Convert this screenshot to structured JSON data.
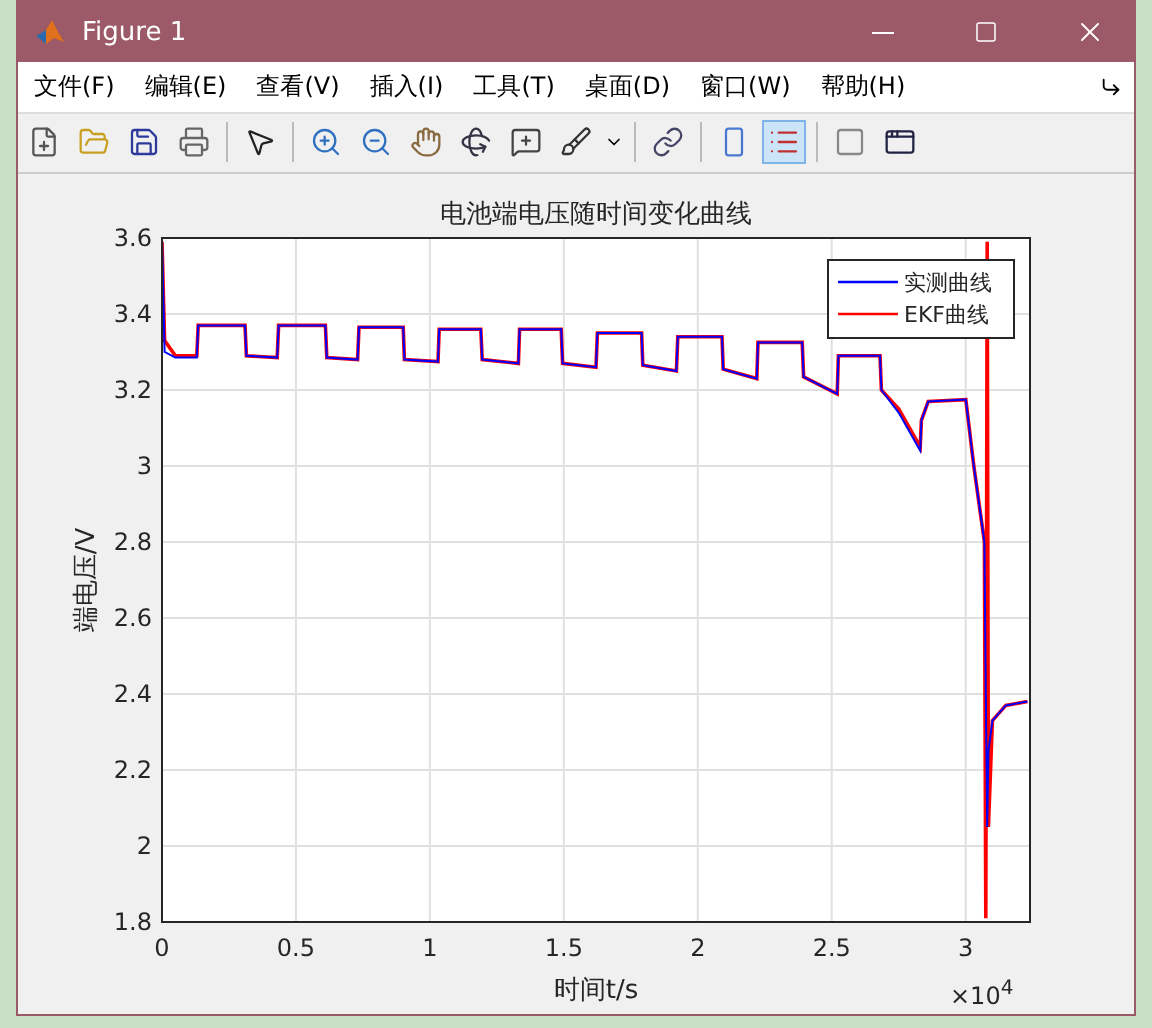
{
  "window": {
    "title": "Figure 1"
  },
  "menu": [
    {
      "label": "文件(F)"
    },
    {
      "label": "编辑(E)"
    },
    {
      "label": "查看(V)"
    },
    {
      "label": "插入(I)"
    },
    {
      "label": "工具(T)"
    },
    {
      "label": "桌面(D)"
    },
    {
      "label": "窗口(W)"
    },
    {
      "label": "帮助(H)"
    }
  ],
  "toolbar": [
    {
      "kind": "new",
      "selected": false
    },
    {
      "kind": "open",
      "selected": false
    },
    {
      "kind": "save",
      "selected": false
    },
    {
      "kind": "print",
      "selected": false
    },
    {
      "kind": "sep"
    },
    {
      "kind": "pointer",
      "selected": false
    },
    {
      "kind": "sep"
    },
    {
      "kind": "zoomin",
      "selected": false
    },
    {
      "kind": "zoomout",
      "selected": false
    },
    {
      "kind": "pan",
      "selected": false
    },
    {
      "kind": "rotate",
      "selected": false
    },
    {
      "kind": "datatip",
      "selected": false
    },
    {
      "kind": "brush",
      "selected": false
    },
    {
      "kind": "sep"
    },
    {
      "kind": "link",
      "selected": false
    },
    {
      "kind": "sep"
    },
    {
      "kind": "colorbar",
      "selected": false
    },
    {
      "kind": "legend",
      "selected": true
    },
    {
      "kind": "sep"
    },
    {
      "kind": "hide",
      "selected": false
    },
    {
      "kind": "window",
      "selected": false
    }
  ],
  "chart_data": {
    "type": "line",
    "title": "电池端电压随时间变化曲线",
    "xlabel": "时间t/s",
    "ylabel": "端电压/V",
    "grid": true,
    "legend": true,
    "annotations": [
      {
        "text": "×10$^{4}$"
      }
    ],
    "xlim": [
      0,
      3.24
    ],
    "ylim": [
      1.8,
      3.6
    ],
    "xticks": [
      0,
      {
        "value": 0.5,
        "label": "0.5"
      },
      1,
      {
        "value": 1.5,
        "label": "1.5"
      },
      2,
      {
        "value": 2.5,
        "label": "2.5"
      },
      3
    ],
    "yticks": [
      {
        "value": 1.8,
        "label": "1.8"
      },
      2,
      {
        "value": 2.2,
        "label": "2.2"
      },
      {
        "value": 2.4,
        "label": "2.4"
      },
      {
        "value": 2.6,
        "label": "2.6"
      },
      {
        "value": 2.8,
        "label": "2.8"
      },
      3,
      {
        "value": 3.2,
        "label": "3.2"
      },
      {
        "value": 3.4,
        "label": "3.4"
      },
      {
        "value": 3.6,
        "label": "3.6"
      }
    ],
    "x": [
      0,
      0.01,
      0.05,
      0.13,
      0.135,
      0.31,
      0.315,
      0.43,
      0.435,
      0.61,
      0.615,
      0.73,
      0.735,
      0.9,
      0.905,
      1.03,
      1.035,
      1.19,
      1.195,
      1.33,
      1.335,
      1.49,
      1.495,
      1.62,
      1.625,
      1.79,
      1.795,
      1.92,
      1.925,
      2.09,
      2.095,
      2.22,
      2.225,
      2.39,
      2.395,
      2.52,
      2.525,
      2.68,
      2.685,
      2.75,
      2.83,
      2.835,
      2.86,
      3.0,
      3.03,
      3.07,
      3.075,
      3.08,
      3.085,
      3.1,
      3.15,
      3.23
    ],
    "series": [
      {
        "name": "实测曲线",
        "color": "#0000ff",
        "values": [
          3.6,
          3.3,
          3.285,
          3.285,
          3.37,
          3.37,
          3.29,
          3.285,
          3.37,
          3.37,
          3.285,
          3.28,
          3.365,
          3.365,
          3.28,
          3.275,
          3.36,
          3.36,
          3.28,
          3.27,
          3.36,
          3.36,
          3.27,
          3.26,
          3.35,
          3.35,
          3.265,
          3.25,
          3.34,
          3.34,
          3.255,
          3.23,
          3.325,
          3.325,
          3.235,
          3.19,
          3.29,
          3.29,
          3.2,
          3.14,
          3.04,
          3.12,
          3.17,
          3.175,
          3.0,
          2.8,
          2.4,
          2.05,
          2.25,
          2.33,
          2.37,
          2.38
        ]
      },
      {
        "name": "EKF曲线",
        "color": "#ff0000",
        "values": [
          3.59,
          3.33,
          3.29,
          3.29,
          3.37,
          3.37,
          3.29,
          3.285,
          3.37,
          3.37,
          3.285,
          3.28,
          3.365,
          3.365,
          3.28,
          3.275,
          3.36,
          3.36,
          3.28,
          3.27,
          3.36,
          3.36,
          3.27,
          3.26,
          3.35,
          3.35,
          3.265,
          3.25,
          3.34,
          3.34,
          3.255,
          3.23,
          3.325,
          3.325,
          3.235,
          3.19,
          3.29,
          3.29,
          3.2,
          3.15,
          3.05,
          3.12,
          3.17,
          3.175,
          3.0,
          2.8,
          1.81,
          3.59,
          2.05,
          2.33,
          2.37,
          2.38
        ]
      }
    ]
  }
}
